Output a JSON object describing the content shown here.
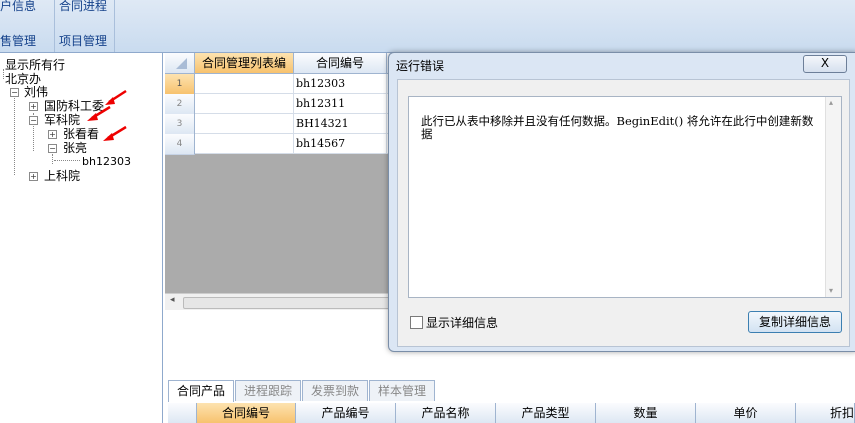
{
  "ribbon": {
    "btn_customer_info": "客户信息",
    "btn_contract_progress": "合同进程",
    "group_sales": "销售管理",
    "group_project": "项目管理"
  },
  "tree": {
    "show_all": "显示所有行",
    "beijing": "北京办",
    "liuwei": "刘伟",
    "guofang": "国防科工委",
    "junke": "军科院",
    "zhangkankan": "张看看",
    "zhangliang": "张亮",
    "bh12303": "bh12303",
    "shangke": "上科院"
  },
  "grid": {
    "headers": [
      "合同管理列表编",
      "合同编号"
    ],
    "rows": [
      {
        "num": "1",
        "code": "bh12303"
      },
      {
        "num": "2",
        "code": "bh12311"
      },
      {
        "num": "3",
        "code": "BH14321"
      },
      {
        "num": "4",
        "code": "bh14567"
      }
    ]
  },
  "tabs": [
    "合同产品",
    "进程跟踪",
    "发票到款",
    "样本管理"
  ],
  "bottom_grid": {
    "headers": [
      "合同编号",
      "产品编号",
      "产品名称",
      "产品类型",
      "数量",
      "单价",
      "折扣"
    ]
  },
  "dialog": {
    "title": "运行错误",
    "close": "X",
    "message": "此行已从表中移除并且没有任何数据。BeginEdit() 将允许在此行中创建新数据",
    "checkbox_label": "显示详细信息",
    "copy_button": "复制详细信息"
  },
  "colors": {
    "selected_header": "#f7c26e",
    "ribbon": "#c9dbef",
    "dialog": "#dbe6f4"
  }
}
